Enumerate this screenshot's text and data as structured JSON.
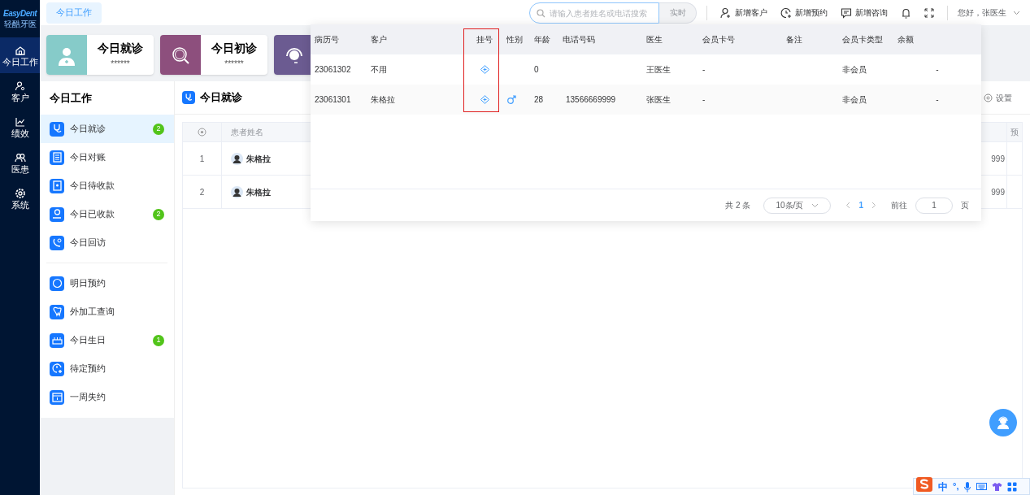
{
  "app": {
    "logo": "EasyDent",
    "logo_subtitle": "轻酷牙医"
  },
  "nav": [
    {
      "label": "今日工作",
      "selected": true
    },
    {
      "label": "客户",
      "selected": false
    },
    {
      "label": "绩效",
      "selected": false
    },
    {
      "label": "医患",
      "selected": false
    },
    {
      "label": "系统",
      "selected": false
    }
  ],
  "tabs": [
    {
      "label": "今日工作",
      "selected": true
    }
  ],
  "search": {
    "placeholder": "请输入患者姓名或电话搜索",
    "button": "实时"
  },
  "actions": [
    {
      "label": "新增客户"
    },
    {
      "label": "新增预约"
    },
    {
      "label": "新增咨询"
    }
  ],
  "greeting": "您好，张医生",
  "stat_cards": [
    {
      "title": "今日就诊",
      "value": "******",
      "color": "#86cbc9"
    },
    {
      "title": "今日初诊",
      "value": "******",
      "color": "#8d4f7d"
    },
    {
      "color": "#6b5b91"
    }
  ],
  "work_panel": {
    "title": "今日工作",
    "groups": [
      [
        {
          "label": "今日就诊",
          "badge": "2",
          "selected": true
        },
        {
          "label": "今日对账",
          "selected": false
        },
        {
          "label": "今日待收款",
          "selected": false
        },
        {
          "label": "今日已收款",
          "badge": "2",
          "selected": false
        },
        {
          "label": "今日回访",
          "selected": false
        }
      ],
      [
        {
          "label": "明日预约",
          "selected": false
        },
        {
          "label": "外加工查询",
          "selected": false
        },
        {
          "label": "今日生日",
          "badge": "1",
          "selected": false
        },
        {
          "label": "待定预约",
          "selected": false
        },
        {
          "label": "一周失约",
          "selected": false
        }
      ]
    ]
  },
  "main": {
    "title": "今日就诊",
    "settings": "设置",
    "columns": {
      "patient_name": "患者姓名",
      "column_cut": "预"
    },
    "rows": [
      {
        "index": "1",
        "name": "朱格拉",
        "phone_fragment": "999"
      },
      {
        "index": "2",
        "name": "朱格拉",
        "phone_fragment": "999"
      }
    ]
  },
  "popup": {
    "columns": [
      "病历号",
      "客户",
      "挂号",
      "性别",
      "年龄",
      "电话号码",
      "医生",
      "会员卡号",
      "备注",
      "会员卡类型",
      "余额"
    ],
    "rows": [
      {
        "record_no": "23061302",
        "customer": "不用",
        "male": false,
        "age": "0",
        "doctor": "王医生",
        "card_no": "-",
        "card_type": "非会员",
        "balance": "-"
      },
      {
        "record_no": "23061301",
        "customer": "朱格拉",
        "male": true,
        "age": "28",
        "phone": "13566669999",
        "doctor": "张医生",
        "card_no": "-",
        "card_type": "非会员",
        "balance": "-"
      }
    ],
    "pagination": {
      "total": "共 2 条",
      "page_size": "10条/页",
      "current_page": "1",
      "goto_label": "前往",
      "goto_value": "1",
      "goto_suffix": "页"
    }
  },
  "ime": {
    "mode": "中",
    "punctuation": "°,"
  }
}
